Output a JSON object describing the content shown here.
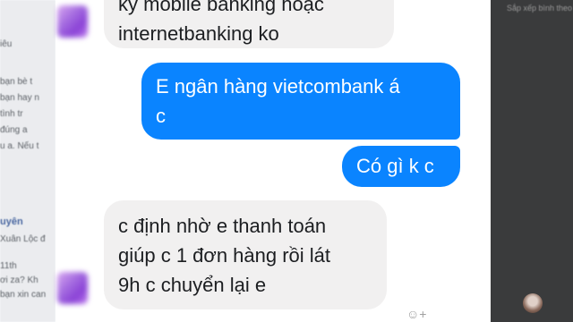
{
  "background": {
    "left_fragments": [
      "iêu",
      "bạn bè t",
      "bạn hay n",
      "tình tr",
      "đúng a",
      "u a. Nếu t",
      "uyên",
      "Xuân Lộc đ",
      "11th",
      "ơi za? Kh",
      "bạn xin can"
    ],
    "right_fragments": [
      "Sắp xếp  bình theo"
    ]
  },
  "messages": [
    {
      "side": "in",
      "lines": [
        "kỳ mobile banking hoặc",
        "internetbanking ko"
      ]
    },
    {
      "side": "out",
      "lines": [
        "E ngân hàng vietcombank á",
        "c"
      ]
    },
    {
      "side": "out",
      "lines": [
        "Có gì k c"
      ]
    },
    {
      "side": "in",
      "lines": [
        "c định nhờ e thanh toán",
        "giúp c 1 đơn hàng rồi lát",
        "9h c chuyển lại e"
      ]
    }
  ],
  "icons": {
    "emoji": "☺+",
    "avatar_1": "pixelated-avatar",
    "avatar_2": "pixelated-avatar",
    "seen": "seen-avatar"
  },
  "colors": {
    "outgoing_bubble": "#0a84ff",
    "incoming_bubble": "#f1f0f0"
  }
}
